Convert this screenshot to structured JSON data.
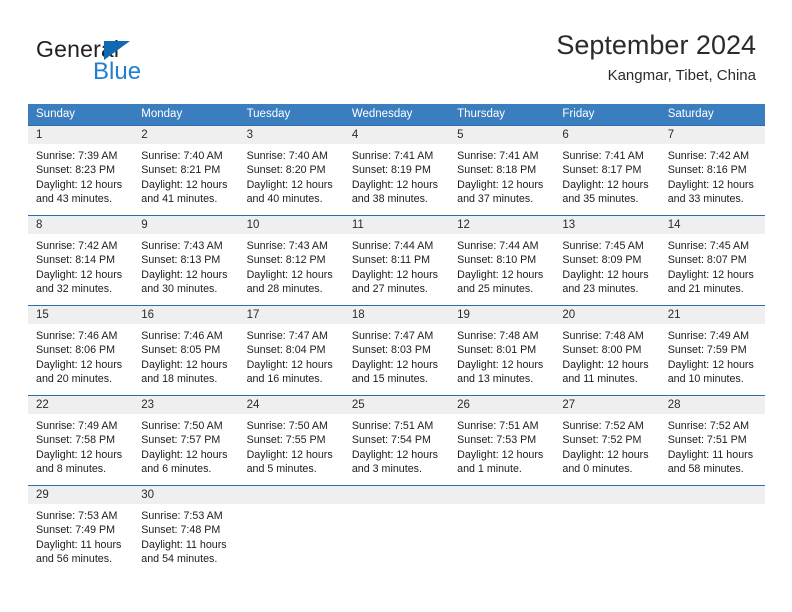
{
  "logo": {
    "primary_text": "General",
    "secondary_text": "Blue",
    "triangle_color": "#1268b3",
    "blue_color": "#1f7fd0"
  },
  "header": {
    "title": "September 2024",
    "subtitle": "Kangmar, Tibet, China"
  },
  "colors": {
    "header_row_bg": "#3a7ebf",
    "row_separator": "#2b6cab",
    "daynum_bg": "#efefef",
    "text": "#1c1c1c"
  },
  "calendar": {
    "weekday_headers": [
      "Sunday",
      "Monday",
      "Tuesday",
      "Wednesday",
      "Thursday",
      "Friday",
      "Saturday"
    ],
    "weeks": [
      [
        {
          "day": "1",
          "sunrise": "Sunrise: 7:39 AM",
          "sunset": "Sunset: 8:23 PM",
          "daylight_line1": "Daylight: 12 hours",
          "daylight_line2": "and 43 minutes."
        },
        {
          "day": "2",
          "sunrise": "Sunrise: 7:40 AM",
          "sunset": "Sunset: 8:21 PM",
          "daylight_line1": "Daylight: 12 hours",
          "daylight_line2": "and 41 minutes."
        },
        {
          "day": "3",
          "sunrise": "Sunrise: 7:40 AM",
          "sunset": "Sunset: 8:20 PM",
          "daylight_line1": "Daylight: 12 hours",
          "daylight_line2": "and 40 minutes."
        },
        {
          "day": "4",
          "sunrise": "Sunrise: 7:41 AM",
          "sunset": "Sunset: 8:19 PM",
          "daylight_line1": "Daylight: 12 hours",
          "daylight_line2": "and 38 minutes."
        },
        {
          "day": "5",
          "sunrise": "Sunrise: 7:41 AM",
          "sunset": "Sunset: 8:18 PM",
          "daylight_line1": "Daylight: 12 hours",
          "daylight_line2": "and 37 minutes."
        },
        {
          "day": "6",
          "sunrise": "Sunrise: 7:41 AM",
          "sunset": "Sunset: 8:17 PM",
          "daylight_line1": "Daylight: 12 hours",
          "daylight_line2": "and 35 minutes."
        },
        {
          "day": "7",
          "sunrise": "Sunrise: 7:42 AM",
          "sunset": "Sunset: 8:16 PM",
          "daylight_line1": "Daylight: 12 hours",
          "daylight_line2": "and 33 minutes."
        }
      ],
      [
        {
          "day": "8",
          "sunrise": "Sunrise: 7:42 AM",
          "sunset": "Sunset: 8:14 PM",
          "daylight_line1": "Daylight: 12 hours",
          "daylight_line2": "and 32 minutes."
        },
        {
          "day": "9",
          "sunrise": "Sunrise: 7:43 AM",
          "sunset": "Sunset: 8:13 PM",
          "daylight_line1": "Daylight: 12 hours",
          "daylight_line2": "and 30 minutes."
        },
        {
          "day": "10",
          "sunrise": "Sunrise: 7:43 AM",
          "sunset": "Sunset: 8:12 PM",
          "daylight_line1": "Daylight: 12 hours",
          "daylight_line2": "and 28 minutes."
        },
        {
          "day": "11",
          "sunrise": "Sunrise: 7:44 AM",
          "sunset": "Sunset: 8:11 PM",
          "daylight_line1": "Daylight: 12 hours",
          "daylight_line2": "and 27 minutes."
        },
        {
          "day": "12",
          "sunrise": "Sunrise: 7:44 AM",
          "sunset": "Sunset: 8:10 PM",
          "daylight_line1": "Daylight: 12 hours",
          "daylight_line2": "and 25 minutes."
        },
        {
          "day": "13",
          "sunrise": "Sunrise: 7:45 AM",
          "sunset": "Sunset: 8:09 PM",
          "daylight_line1": "Daylight: 12 hours",
          "daylight_line2": "and 23 minutes."
        },
        {
          "day": "14",
          "sunrise": "Sunrise: 7:45 AM",
          "sunset": "Sunset: 8:07 PM",
          "daylight_line1": "Daylight: 12 hours",
          "daylight_line2": "and 21 minutes."
        }
      ],
      [
        {
          "day": "15",
          "sunrise": "Sunrise: 7:46 AM",
          "sunset": "Sunset: 8:06 PM",
          "daylight_line1": "Daylight: 12 hours",
          "daylight_line2": "and 20 minutes."
        },
        {
          "day": "16",
          "sunrise": "Sunrise: 7:46 AM",
          "sunset": "Sunset: 8:05 PM",
          "daylight_line1": "Daylight: 12 hours",
          "daylight_line2": "and 18 minutes."
        },
        {
          "day": "17",
          "sunrise": "Sunrise: 7:47 AM",
          "sunset": "Sunset: 8:04 PM",
          "daylight_line1": "Daylight: 12 hours",
          "daylight_line2": "and 16 minutes."
        },
        {
          "day": "18",
          "sunrise": "Sunrise: 7:47 AM",
          "sunset": "Sunset: 8:03 PM",
          "daylight_line1": "Daylight: 12 hours",
          "daylight_line2": "and 15 minutes."
        },
        {
          "day": "19",
          "sunrise": "Sunrise: 7:48 AM",
          "sunset": "Sunset: 8:01 PM",
          "daylight_line1": "Daylight: 12 hours",
          "daylight_line2": "and 13 minutes."
        },
        {
          "day": "20",
          "sunrise": "Sunrise: 7:48 AM",
          "sunset": "Sunset: 8:00 PM",
          "daylight_line1": "Daylight: 12 hours",
          "daylight_line2": "and 11 minutes."
        },
        {
          "day": "21",
          "sunrise": "Sunrise: 7:49 AM",
          "sunset": "Sunset: 7:59 PM",
          "daylight_line1": "Daylight: 12 hours",
          "daylight_line2": "and 10 minutes."
        }
      ],
      [
        {
          "day": "22",
          "sunrise": "Sunrise: 7:49 AM",
          "sunset": "Sunset: 7:58 PM",
          "daylight_line1": "Daylight: 12 hours",
          "daylight_line2": "and 8 minutes."
        },
        {
          "day": "23",
          "sunrise": "Sunrise: 7:50 AM",
          "sunset": "Sunset: 7:57 PM",
          "daylight_line1": "Daylight: 12 hours",
          "daylight_line2": "and 6 minutes."
        },
        {
          "day": "24",
          "sunrise": "Sunrise: 7:50 AM",
          "sunset": "Sunset: 7:55 PM",
          "daylight_line1": "Daylight: 12 hours",
          "daylight_line2": "and 5 minutes."
        },
        {
          "day": "25",
          "sunrise": "Sunrise: 7:51 AM",
          "sunset": "Sunset: 7:54 PM",
          "daylight_line1": "Daylight: 12 hours",
          "daylight_line2": "and 3 minutes."
        },
        {
          "day": "26",
          "sunrise": "Sunrise: 7:51 AM",
          "sunset": "Sunset: 7:53 PM",
          "daylight_line1": "Daylight: 12 hours",
          "daylight_line2": "and 1 minute."
        },
        {
          "day": "27",
          "sunrise": "Sunrise: 7:52 AM",
          "sunset": "Sunset: 7:52 PM",
          "daylight_line1": "Daylight: 12 hours",
          "daylight_line2": "and 0 minutes."
        },
        {
          "day": "28",
          "sunrise": "Sunrise: 7:52 AM",
          "sunset": "Sunset: 7:51 PM",
          "daylight_line1": "Daylight: 11 hours",
          "daylight_line2": "and 58 minutes."
        }
      ],
      [
        {
          "day": "29",
          "sunrise": "Sunrise: 7:53 AM",
          "sunset": "Sunset: 7:49 PM",
          "daylight_line1": "Daylight: 11 hours",
          "daylight_line2": "and 56 minutes."
        },
        {
          "day": "30",
          "sunrise": "Sunrise: 7:53 AM",
          "sunset": "Sunset: 7:48 PM",
          "daylight_line1": "Daylight: 11 hours",
          "daylight_line2": "and 54 minutes."
        },
        {
          "day": "",
          "sunrise": "",
          "sunset": "",
          "daylight_line1": "",
          "daylight_line2": ""
        },
        {
          "day": "",
          "sunrise": "",
          "sunset": "",
          "daylight_line1": "",
          "daylight_line2": ""
        },
        {
          "day": "",
          "sunrise": "",
          "sunset": "",
          "daylight_line1": "",
          "daylight_line2": ""
        },
        {
          "day": "",
          "sunrise": "",
          "sunset": "",
          "daylight_line1": "",
          "daylight_line2": ""
        },
        {
          "day": "",
          "sunrise": "",
          "sunset": "",
          "daylight_line1": "",
          "daylight_line2": ""
        }
      ]
    ]
  }
}
